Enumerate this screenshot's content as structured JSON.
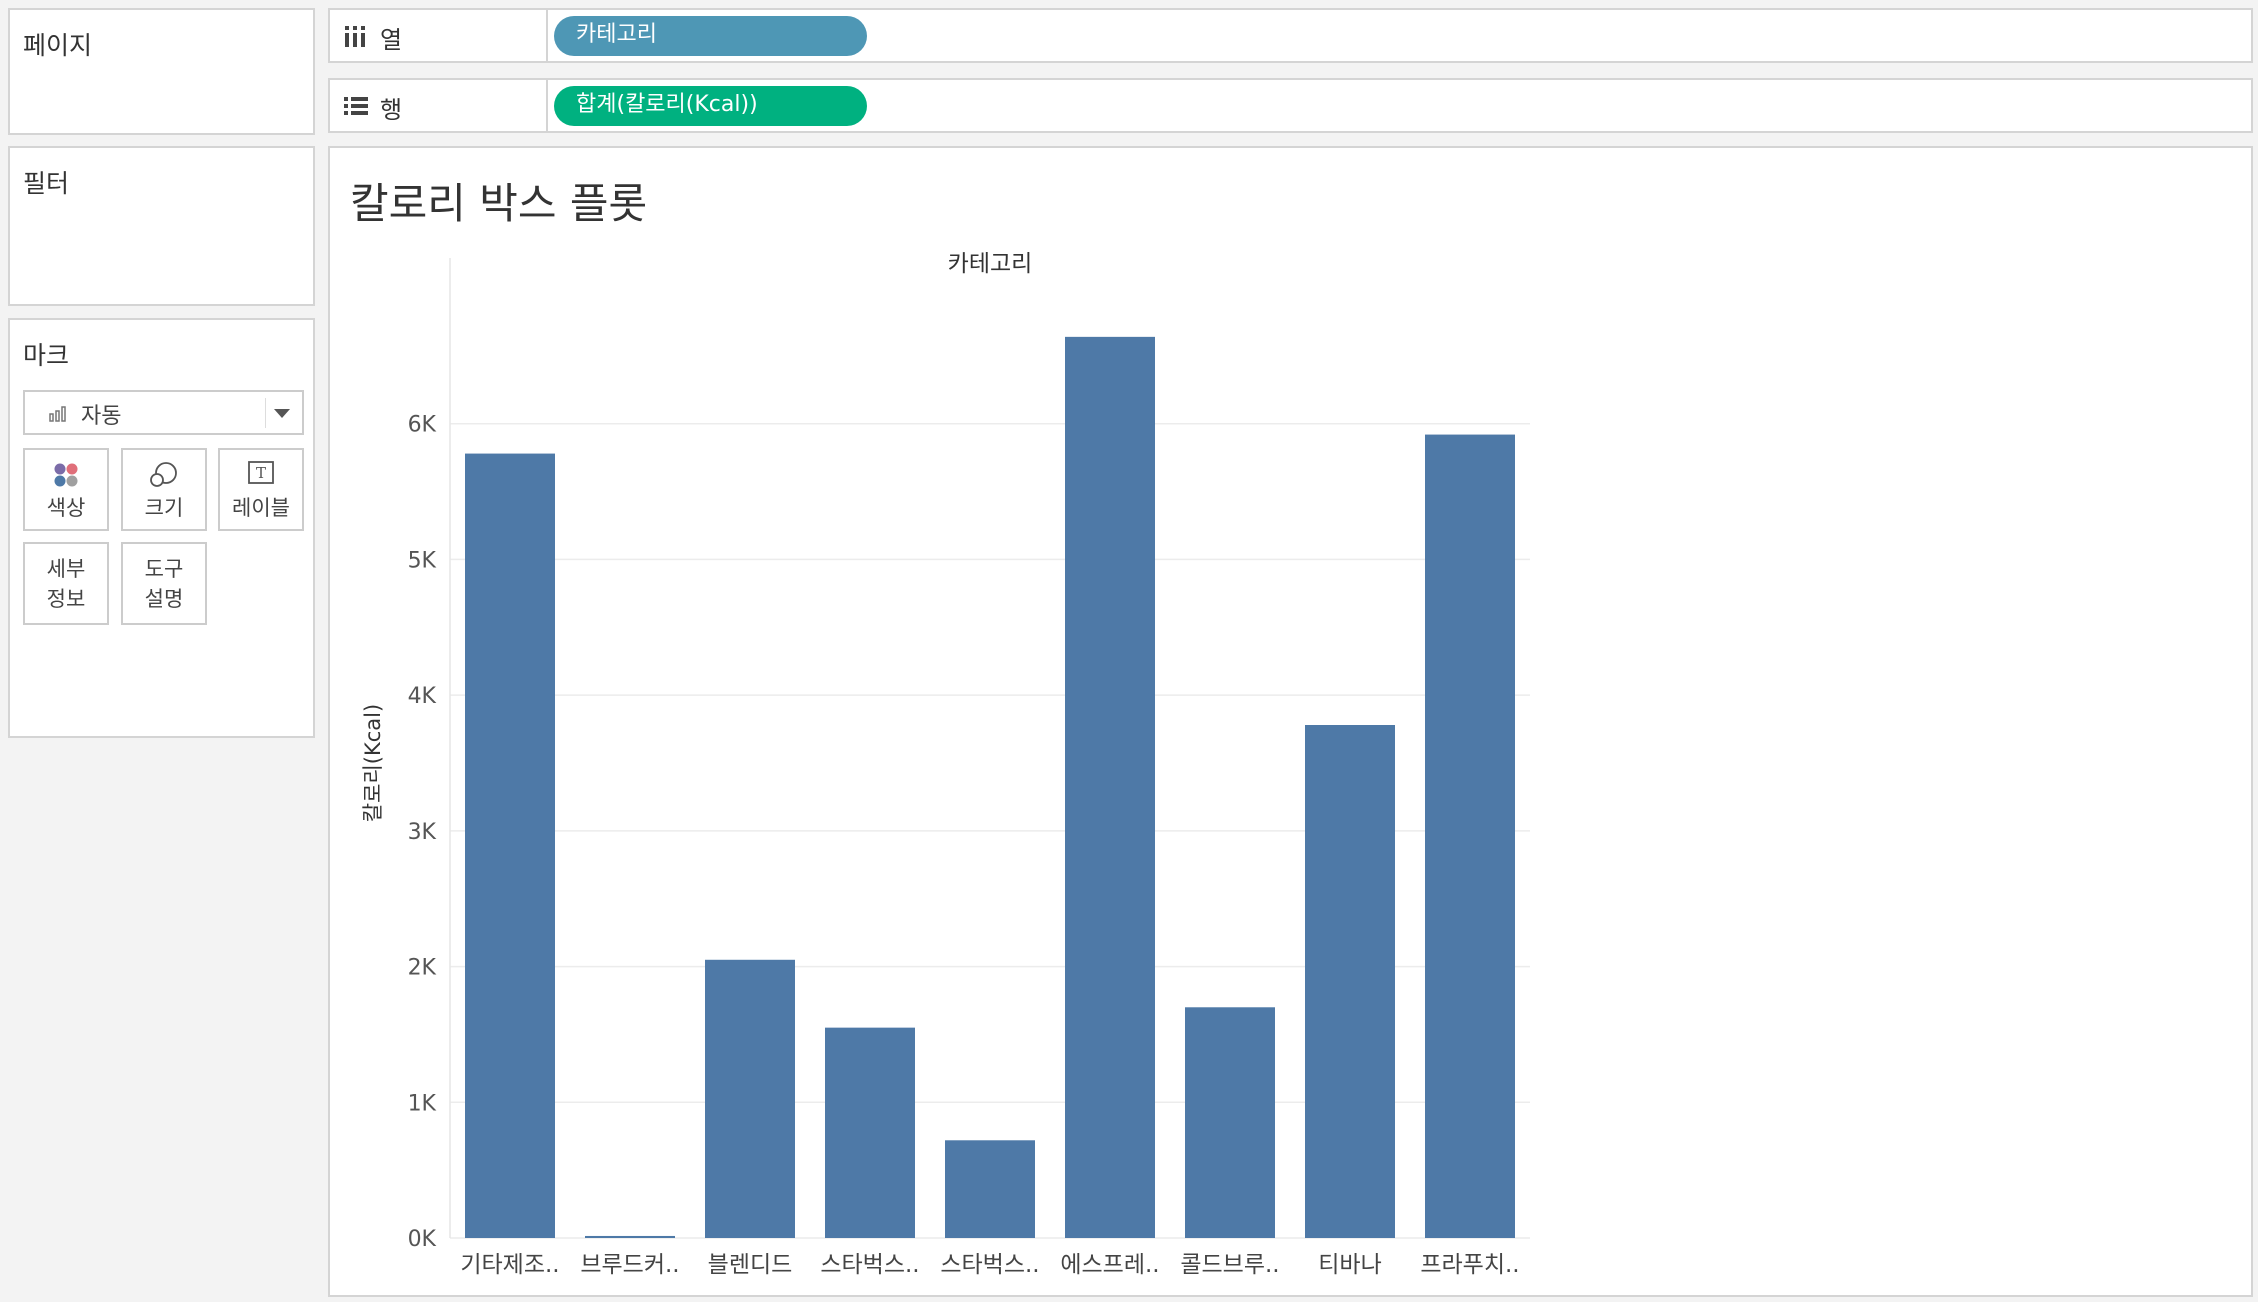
{
  "sidebar": {
    "pages_title": "페이지",
    "filters_title": "필터",
    "marks_title": "마크",
    "mark_type": "자동",
    "mark_buttons": {
      "color": "색상",
      "size": "크기",
      "label": "레이블",
      "detail_line1": "세부",
      "detail_line2": "정보",
      "tooltip_line1": "도구",
      "tooltip_line2": "설명"
    }
  },
  "shelves": {
    "columns_label": "열",
    "columns_pill": "카테고리",
    "rows_label": "행",
    "rows_pill": "합계(칼로리(Kcal))"
  },
  "colors": {
    "bar": "#4e79a7",
    "columns_pill": "#4e97b5",
    "rows_pill": "#00b180"
  },
  "chart_data": {
    "type": "bar",
    "title": "칼로리 박스 플롯",
    "xlabel": "카테고리",
    "ylabel": "칼로리(Kcal)",
    "ylim": [
      0,
      7000
    ],
    "yticks": [
      0,
      1000,
      2000,
      3000,
      4000,
      5000,
      6000
    ],
    "ytick_labels": [
      "0K",
      "1K",
      "2K",
      "3K",
      "4K",
      "5K",
      "6K"
    ],
    "categories": [
      "기타제조..",
      "브루드커..",
      "블렌디드",
      "스타벅스..",
      "스타벅스..",
      "에스프레..",
      "콜드브루..",
      "티바나",
      "프라푸치.."
    ],
    "values": [
      5780,
      15,
      2050,
      1550,
      720,
      6640,
      1700,
      3780,
      5920
    ],
    "grid": true
  }
}
